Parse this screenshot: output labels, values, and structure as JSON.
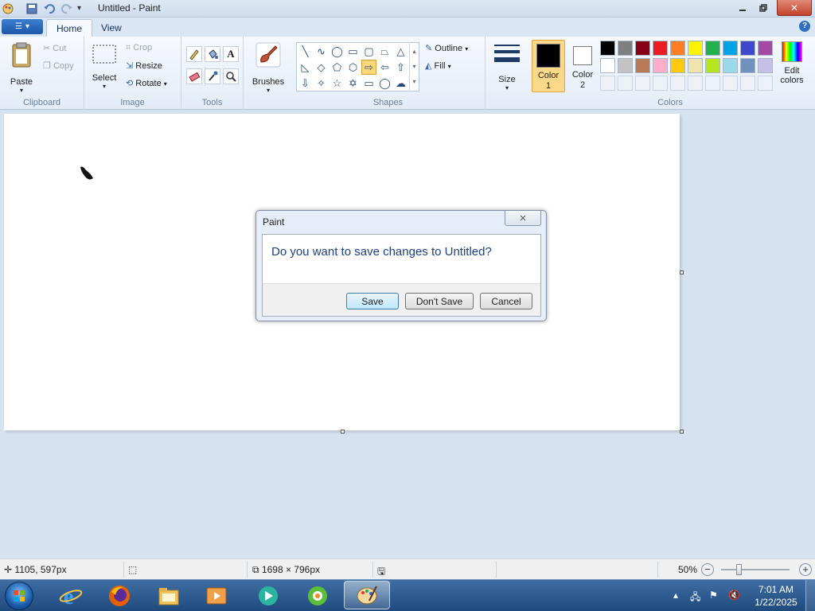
{
  "window": {
    "title": "Untitled - Paint"
  },
  "tabs": [
    {
      "label": "Home"
    },
    {
      "label": "View"
    }
  ],
  "ribbon": {
    "clipboard": {
      "paste": "Paste",
      "cut": "Cut",
      "copy": "Copy",
      "group": "Clipboard"
    },
    "image": {
      "select": "Select",
      "crop": "Crop",
      "resize": "Resize",
      "rotate": "Rotate",
      "group": "Image"
    },
    "tools": {
      "group": "Tools"
    },
    "brushes": {
      "label": "Brushes"
    },
    "shapes": {
      "group": "Shapes",
      "outline": "Outline",
      "fill": "Fill"
    },
    "size": {
      "label": "Size"
    },
    "color1": {
      "label1": "Color",
      "label2": "1",
      "value": "#000000"
    },
    "color2": {
      "label1": "Color",
      "label2": "2",
      "value": "#ffffff"
    },
    "colors": {
      "group": "Colors",
      "edit1": "Edit",
      "edit2": "colors",
      "palette": [
        [
          "#000000",
          "#7f7f7f",
          "#880015",
          "#ed1c24",
          "#ff7f27",
          "#fff200",
          "#22b14c",
          "#00a2e8",
          "#3f48cc",
          "#a349a4"
        ],
        [
          "#ffffff",
          "#c3c3c3",
          "#b97a57",
          "#ffaec9",
          "#ffc90e",
          "#efe4b0",
          "#b5e61d",
          "#99d9ea",
          "#7092be",
          "#c8bfe7"
        ]
      ]
    }
  },
  "dialog": {
    "title": "Paint",
    "message": "Do you want to save changes to Untitled?",
    "save": "Save",
    "dont_save": "Don't Save",
    "cancel": "Cancel"
  },
  "status": {
    "cursor_pos": "1105, 597px",
    "canvas_size": "1698 × 796px",
    "zoom": "50%"
  },
  "taskbar": {
    "time": "7:01 AM",
    "date": "1/22/2025"
  }
}
